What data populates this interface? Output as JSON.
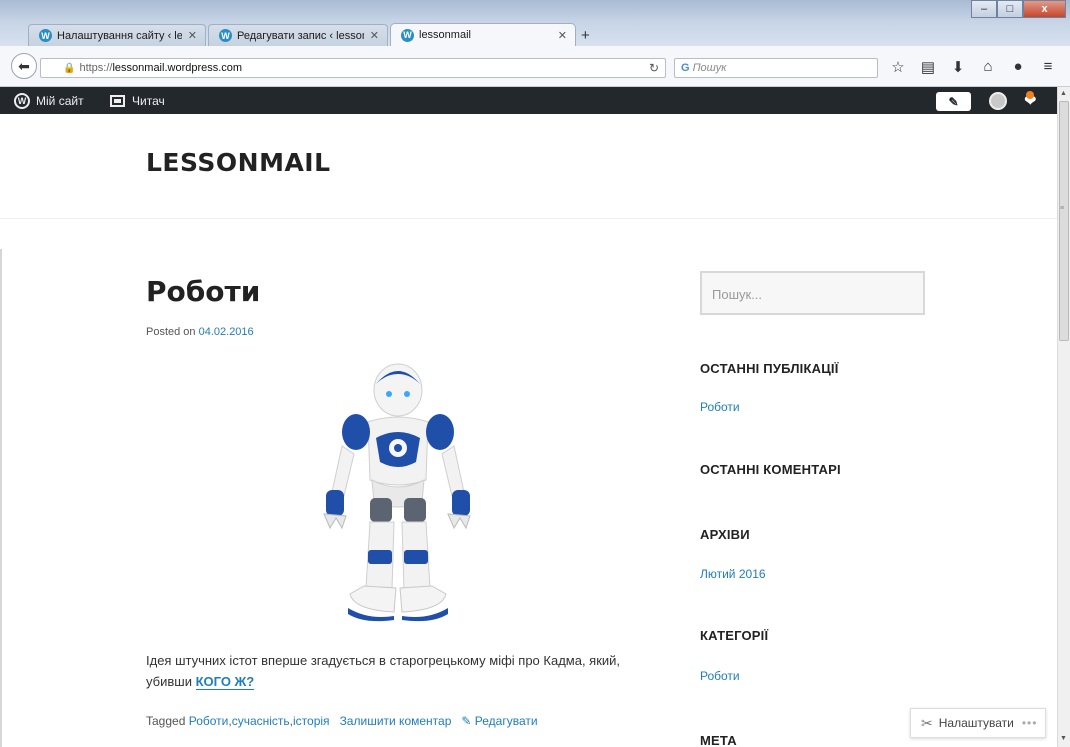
{
  "browser": {
    "tabs": [
      {
        "title": "Налаштування сайту ‹ les...",
        "active": false
      },
      {
        "title": "Редагувати запис ‹ lesson...",
        "active": false
      },
      {
        "title": "lessonmail",
        "active": true
      }
    ],
    "new_tab": "+",
    "url_scheme": "https://",
    "url_host": "lessonmail.wordpress.com",
    "search_placeholder": "Пошук",
    "window_controls": {
      "minimize": "–",
      "maximize": "□",
      "close": "x"
    }
  },
  "adminbar": {
    "my_site": "Мій сайт",
    "reader": "Читач",
    "write_icon": "pencil-square-icon",
    "notification_dot_color": "#f0821e"
  },
  "site": {
    "title": "LESSONMAIL"
  },
  "post": {
    "title": "Роботи",
    "posted_on_label": "Posted on",
    "date": "04.02.2016",
    "excerpt_line1": "Ідея штучних істот вперше згадується в старогрецькому міфі про Кадма, який,",
    "excerpt_line2": "убивши",
    "more_link": "КОГО Ж?",
    "tagged_label": "Tagged",
    "tags": [
      "Роботи",
      "сучасність",
      "історія"
    ],
    "tag_sep": ", ",
    "comment_link": "Залишити коментар",
    "edit_link": "Редагувати"
  },
  "sidebar": {
    "search_placeholder": "Пошук...",
    "recent_posts_heading": "ОСТАННІ ПУБЛІКАЦІЇ",
    "recent_posts": [
      "Роботи"
    ],
    "recent_comments_heading": "ОСТАННІ КОМЕНТАРІ",
    "archives_heading": "АРХІВИ",
    "archives": [
      "Лютий 2016"
    ],
    "categories_heading": "КАТЕГОРІЇ",
    "categories": [
      "Роботи"
    ],
    "meta_heading": "МЕТА"
  },
  "customize_button": "Налаштувати",
  "colors": {
    "link": "#1f7dbc",
    "adminbar": "#23282d",
    "robot_blue": "#1f4fa8"
  }
}
